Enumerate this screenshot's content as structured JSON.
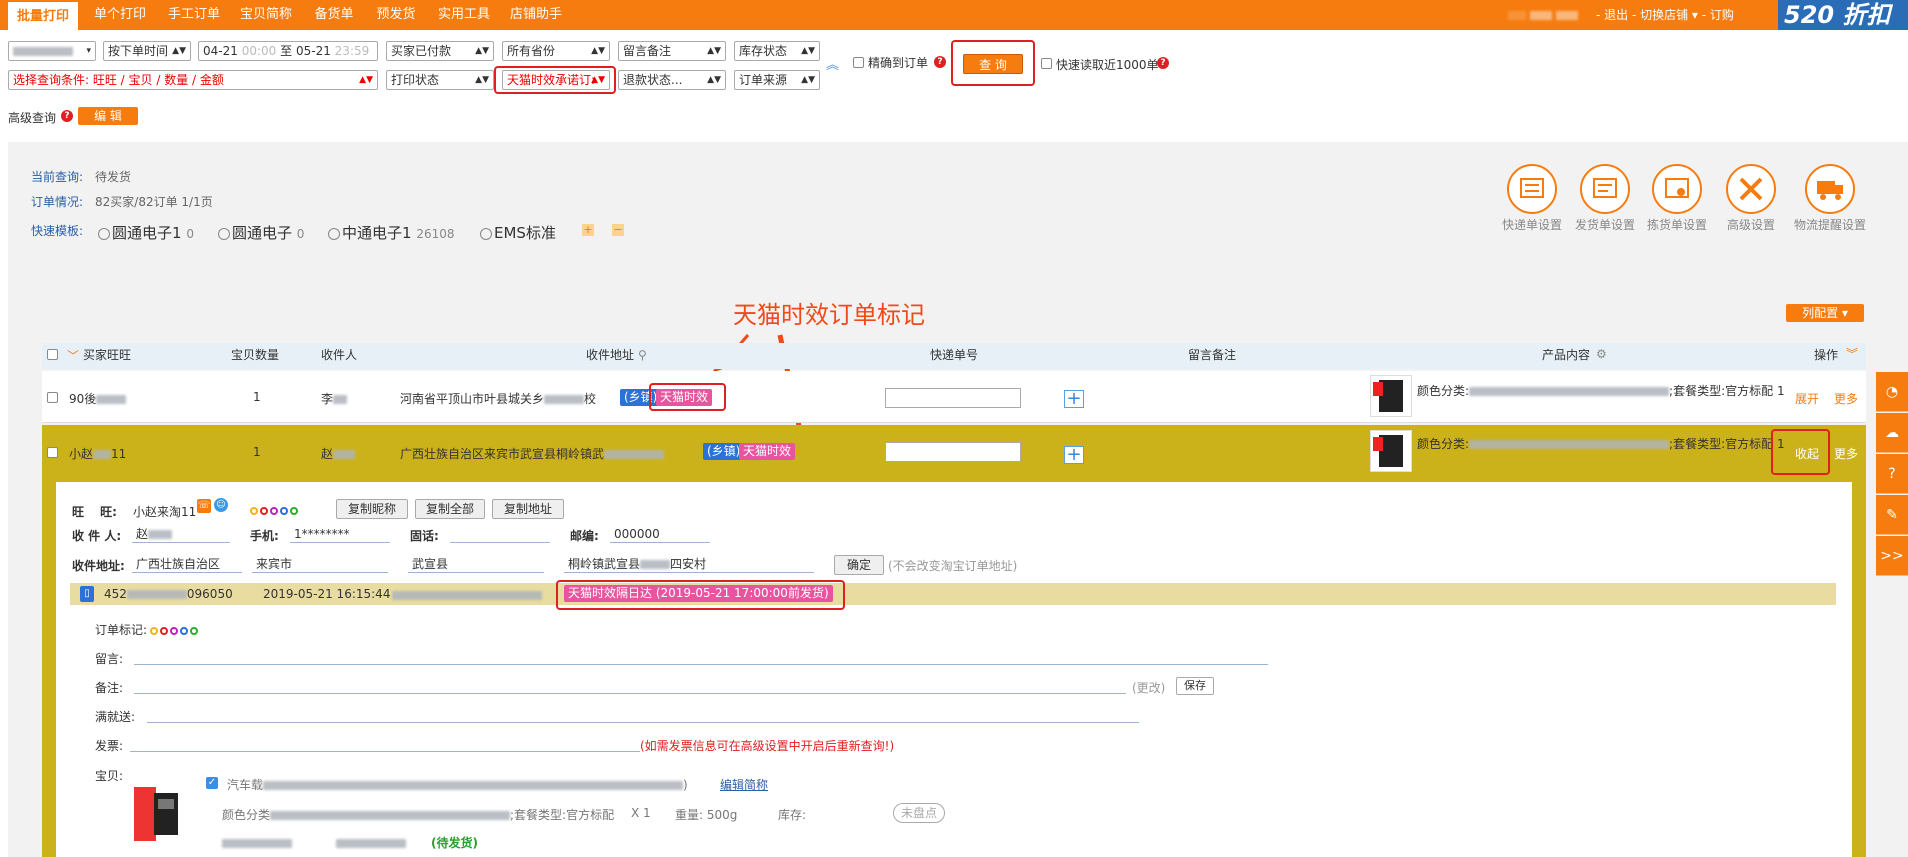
{
  "nav": {
    "tabs": [
      "批量打印",
      "单个打印",
      "手工订单",
      "宝贝简称",
      "备货单",
      "预发货",
      "实用工具",
      "店铺助手"
    ],
    "user_links": "- 退出 - 切换店铺 ▾ - 订购",
    "brand": "520 折扣"
  },
  "filters": {
    "row1": {
      "time_type": "按下单时间",
      "date_from": "04-21",
      "time_from": "00:00",
      "date_sep": "至",
      "date_to": "05-21",
      "time_to": "23:59",
      "payment": "买家已付款",
      "province": "所有省份",
      "remark": "留言备注",
      "stock": "库存状态",
      "exact_label": "精确到订单",
      "query_btn": "查 询",
      "fast_label": "快速读取近1000单"
    },
    "row2": {
      "condition": "选择查询条件: 旺旺 / 宝贝 / 数量 / 金额",
      "print_status": "打印状态",
      "tmall_promise": "天猫时效承诺订:",
      "refund": "退款状态...",
      "source": "订单来源"
    },
    "advanced_label": "高级查询",
    "edit_btn": "编 辑"
  },
  "summary": {
    "current_query_label": "当前查询:",
    "current_query_value": "待发货",
    "order_status_label": "订单情况:",
    "order_status_value": "82买家/82订单  1/1页",
    "template_label": "快速模板:",
    "templates": [
      {
        "name": "圆通电子1",
        "count": "0"
      },
      {
        "name": "圆通电子",
        "count": "0"
      },
      {
        "name": "中通电子1",
        "count": "26108"
      },
      {
        "name": "EMS标准",
        "count": ""
      }
    ]
  },
  "shortcuts": [
    "快递单设置",
    "发货单设置",
    "拣货单设置",
    "高级设置",
    "物流提醒设置"
  ],
  "annotation": "天猫时效订单标记",
  "column_config": "列配置",
  "table": {
    "headers": [
      "买家旺旺",
      "宝贝数量",
      "收件人",
      "收件地址",
      "快递单号",
      "留言备注",
      "产品内容",
      "操作"
    ]
  },
  "rows": [
    {
      "buyer": "90後",
      "qty": "1",
      "recipient": "李",
      "address": "河南省平顶山市叶县城关乡",
      "address_tail": "校",
      "tag_town": "(乡镇)",
      "tag_tmall": "天猫时效",
      "product": "颜色分类:",
      "product_tail": ";套餐类型:官方标配 1",
      "op1": "展开",
      "op2": "更多"
    },
    {
      "buyer": "小赵",
      "buyer_tail": "11",
      "qty": "1",
      "recipient": "赵",
      "address": "广西壮族自治区来宾市武宣县桐岭镇武",
      "tag_town": "(乡镇)",
      "tag_tmall": "天猫时效",
      "product": "颜色分类:",
      "product_tail": ";套餐类型:官方标配 1",
      "op1": "收起",
      "op2": "更多"
    }
  ],
  "detail": {
    "ww_label": "旺　 旺:",
    "ww_value": "小赵来淘11",
    "copy_nick": "复制昵称",
    "copy_all": "复制全部",
    "copy_addr": "复制地址",
    "recipient_label": "收 件 人:",
    "recipient_value": "赵",
    "phone_label": "手机:",
    "phone_value": "1********",
    "tel_label": "固话:",
    "zip_label": "邮编:",
    "zip_value": "000000",
    "addr_label": "收件地址:",
    "addr_province": "广西壮族自治区",
    "addr_city": "来宾市",
    "addr_county": "武宣县",
    "addr_street": "桐岭镇武宣县",
    "addr_street_tail": "四安村",
    "confirm_btn": "确定",
    "no_change_note": "(不会改变淘宝订单地址)",
    "order_no_head": "452",
    "order_no_tail": "096050",
    "order_time": "2019-05-21 16:15:44",
    "tmall_next_day": "天猫时效隔日达 (2019-05-21 17:00:00前发货)",
    "mark_label": "订单标记:",
    "msg_label": "留言:",
    "note_label": "备注:",
    "note_change": "(更改)",
    "save_btn": "保存",
    "gift_label": "满就送:",
    "invoice_label": "发票:",
    "invoice_note": "(如需发票信息可在高级设置中开启后重新查询!)",
    "item_label": "宝贝:",
    "item_title": "汽车载",
    "item_title_tail": ")",
    "edit_short": "编辑简称",
    "item_spec": "颜色分类",
    "item_spec_tail": ";套餐类型:官方标配",
    "item_qty": "X 1",
    "weight": "重量: 500g",
    "stock_label": "库存:",
    "not_counted": "未盘点",
    "pending": "(待发货)"
  },
  "sidebar": [
    ">>"
  ]
}
